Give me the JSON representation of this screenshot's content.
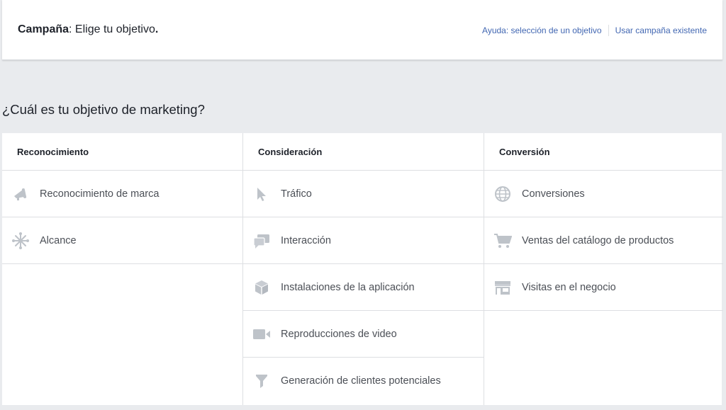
{
  "header": {
    "title_strong": "Campaña",
    "title_rest": ": Elige tu objetivo",
    "title_dot": ".",
    "help_link": "Ayuda: selección de un objetivo",
    "existing_link": "Usar campaña existente"
  },
  "question": "¿Cuál es tu objetivo de marketing?",
  "colors": {
    "link": "#4267b2",
    "icon": "#bec3c9",
    "border": "#dddfe2",
    "background": "#e9ebee"
  },
  "columns": [
    {
      "heading": "Reconocimiento",
      "options": [
        {
          "label": "Reconocimiento de marca",
          "icon": "megaphone-icon"
        },
        {
          "label": "Alcance",
          "icon": "asterisk-icon"
        }
      ]
    },
    {
      "heading": "Consideración",
      "options": [
        {
          "label": "Tráfico",
          "icon": "cursor-icon"
        },
        {
          "label": "Interacción",
          "icon": "chat-bubbles-icon"
        },
        {
          "label": "Instalaciones de la aplicación",
          "icon": "box-icon"
        },
        {
          "label": "Reproducciones de video",
          "icon": "video-camera-icon"
        },
        {
          "label": "Generación de clientes potenciales",
          "icon": "funnel-icon"
        }
      ]
    },
    {
      "heading": "Conversión",
      "options": [
        {
          "label": "Conversiones",
          "icon": "globe-icon"
        },
        {
          "label": "Ventas del catálogo de productos",
          "icon": "shopping-cart-icon"
        },
        {
          "label": "Visitas en el negocio",
          "icon": "storefront-icon"
        }
      ]
    }
  ]
}
